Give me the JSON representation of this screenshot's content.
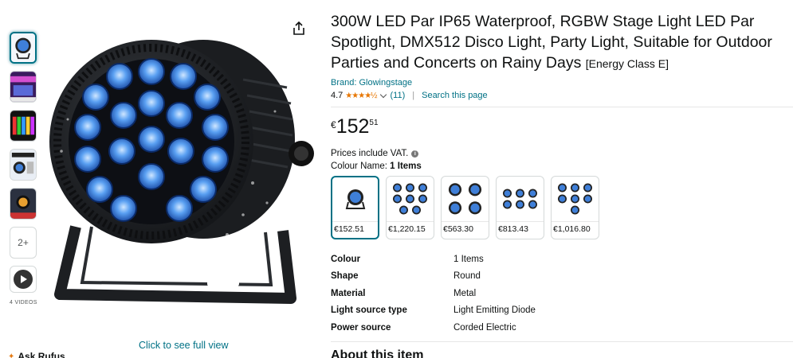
{
  "product": {
    "title": "300W LED Par IP65 Waterproof, RGBW Stage Light LED Par Spotlight, DMX512 Disco Light, Party Light, Suitable for Outdoor Parties and Concerts on Rainy Days",
    "energy_class": "[Energy Class E]",
    "brand_link": "Brand: Glowingstage",
    "rating": "4.7",
    "review_count": "(11)",
    "search_page_link": "Search this page",
    "price_currency": "€",
    "price_whole": "152",
    "price_fraction": "51",
    "vat_note": "Prices include VAT.",
    "colour_label": "Colour Name:",
    "colour_value": "1 Items"
  },
  "gallery": {
    "videos_label": "4 VIDEOS",
    "more_label": "2+",
    "full_view_link": "Click to see full view",
    "rufus_label": "Ask Rufus"
  },
  "swatches": [
    {
      "price": "€152.51"
    },
    {
      "price": "€1,220.15"
    },
    {
      "price": "€563.30"
    },
    {
      "price": "€813.43"
    },
    {
      "price": "€1,016.80"
    }
  ],
  "specs": [
    {
      "key": "Colour",
      "value": "1 Items"
    },
    {
      "key": "Shape",
      "value": "Round"
    },
    {
      "key": "Material",
      "value": "Metal"
    },
    {
      "key": "Light source type",
      "value": "Light Emitting Diode"
    },
    {
      "key": "Power source",
      "value": "Corded Electric"
    }
  ],
  "about_heading": "About this item",
  "colors": {
    "link": "#007185",
    "star": "#e77600",
    "led_blue": "#4a8fe8"
  }
}
